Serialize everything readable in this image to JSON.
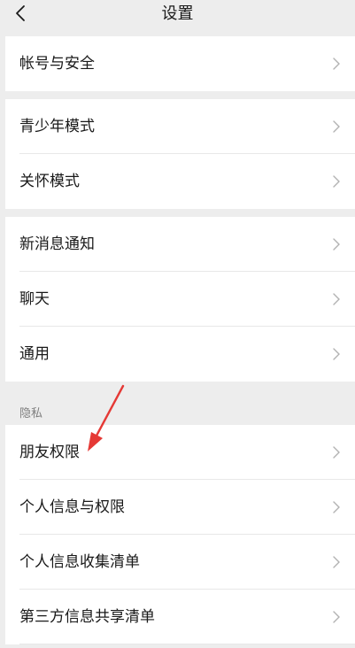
{
  "header": {
    "title": "设置",
    "back_icon": "chevron-left-icon"
  },
  "groups": [
    {
      "items": [
        "帐号与安全"
      ]
    },
    {
      "items": [
        "青少年模式",
        "关怀模式"
      ]
    },
    {
      "items": [
        "新消息通知",
        "聊天",
        "通用"
      ]
    }
  ],
  "privacy": {
    "title": "隐私",
    "items": [
      "朋友权限",
      "个人信息与权限",
      "个人信息收集清单",
      "第三方信息共享清单"
    ]
  },
  "annotation": {
    "color": "#e53935",
    "target": "朋友权限"
  }
}
